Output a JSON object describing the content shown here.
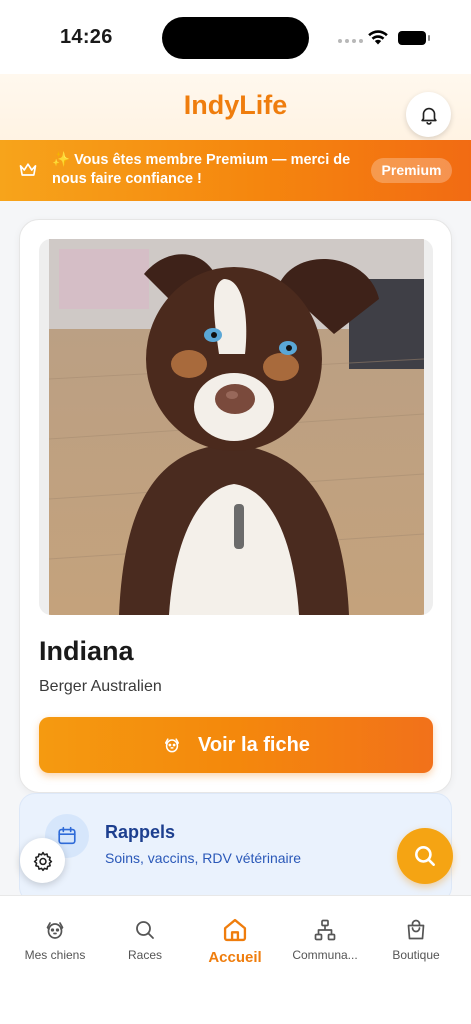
{
  "status_bar": {
    "time": "14:26"
  },
  "header": {
    "app_title": "IndyLife",
    "bell_icon": "bell-icon"
  },
  "premium_banner": {
    "message": "✨ Vous êtes membre Premium — merci de nous faire confiance !",
    "badge": "Premium",
    "icon": "crown-icon"
  },
  "dog_card": {
    "name": "Indiana",
    "breed": "Berger Australien",
    "button_label": "Voir la fiche",
    "button_icon": "dog-face-icon"
  },
  "reminders": {
    "title": "Rappels",
    "subtitle": "Soins, vaccins, RDV vétérinaire",
    "icon": "calendar-icon"
  },
  "tabs": [
    {
      "label": "Mes chiens",
      "icon": "dog-face-icon",
      "active": false
    },
    {
      "label": "Races",
      "icon": "search-icon",
      "active": false
    },
    {
      "label": "Accueil",
      "icon": "home-icon",
      "active": true
    },
    {
      "label": "Communa...",
      "icon": "network-icon",
      "active": false
    },
    {
      "label": "Boutique",
      "icon": "shopping-bag-icon",
      "active": false
    }
  ],
  "colors": {
    "accent": "#ef7d0d",
    "banner_start": "#f7a41b",
    "banner_end": "#f26b13",
    "reminder_bg": "#eaf2fd",
    "reminder_title": "#1d3f8f"
  }
}
